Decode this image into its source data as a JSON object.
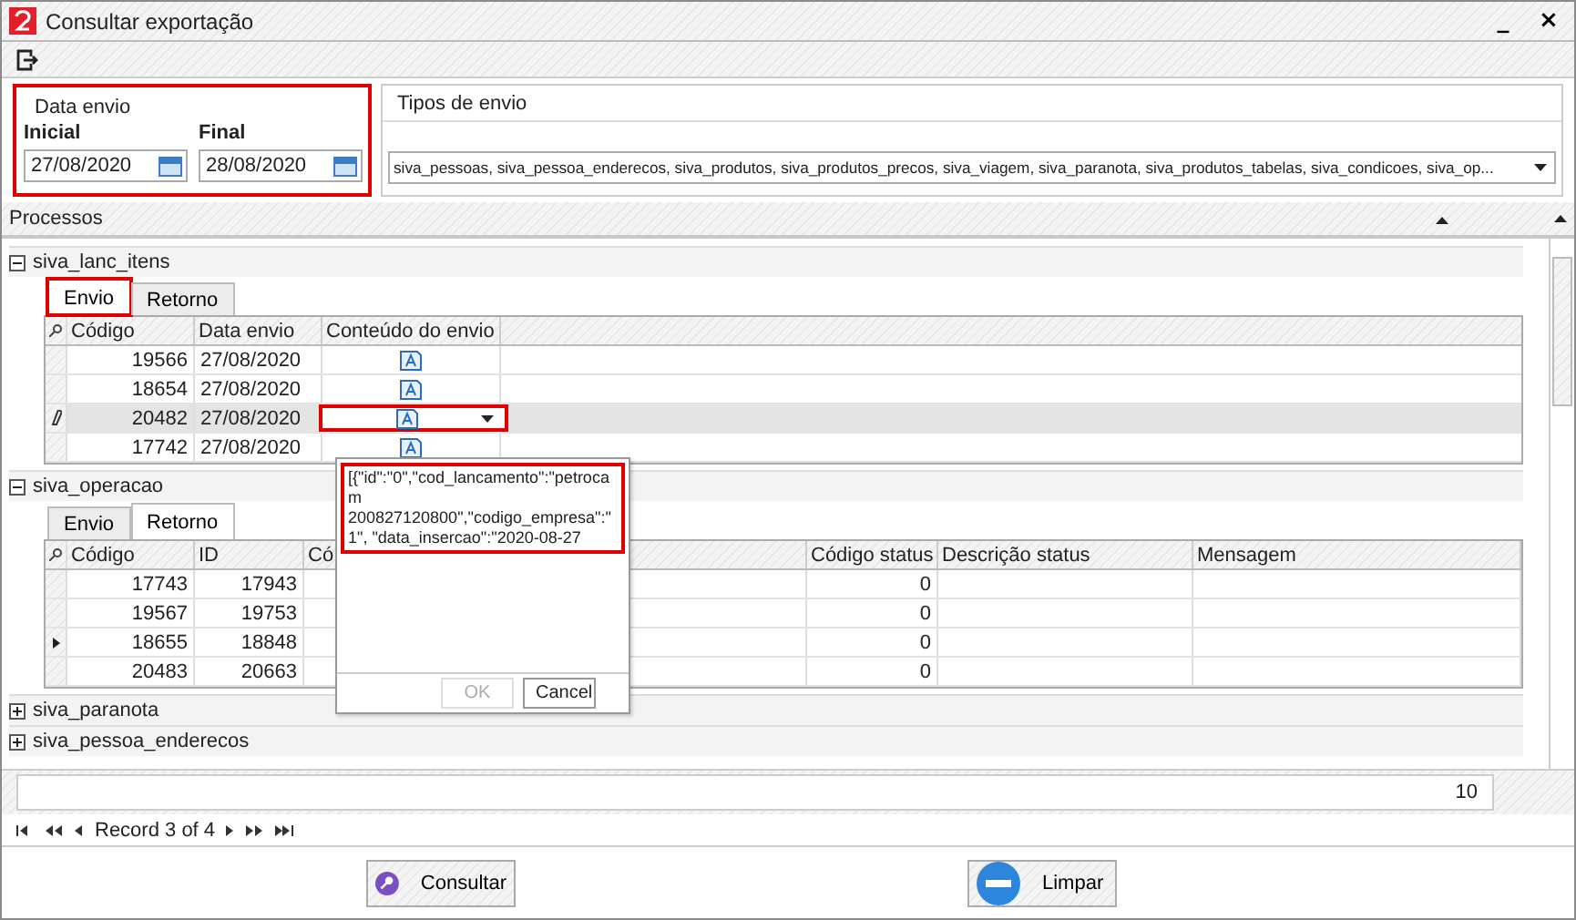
{
  "window": {
    "title": "Consultar exportação",
    "controls": [
      "_",
      "×"
    ]
  },
  "date_filter": {
    "title": "Data envio",
    "highlighted": true,
    "fields": [
      {
        "label": "Inicial",
        "value": "27/08/2020"
      },
      {
        "label": "Final",
        "value": "28/08/2020"
      }
    ]
  },
  "send_types": {
    "title": "Tipos de envio",
    "value": "siva_pessoas, siva_pessoa_enderecos, siva_produtos, siva_produtos_precos, siva_viagem, siva_paranota, siva_produtos_tabelas, siva_condicoes, siva_op..."
  },
  "processes": {
    "title": "Processos",
    "groups": [
      {
        "name": "siva_lanc_itens",
        "expanded": true,
        "tabs": [
          {
            "label": "Envio",
            "selected": true,
            "highlighted": true
          },
          {
            "label": "Retorno",
            "selected": false,
            "highlighted": false
          }
        ],
        "grid": {
          "editing": true,
          "editor_highlighted": true,
          "columns": [
            {
              "label": "Código",
              "kind": "number"
            },
            {
              "label": "Data envio",
              "kind": "text"
            },
            {
              "label": "Conteúdo do envio",
              "kind": "content"
            }
          ],
          "rows": [
            {
              "selected": false,
              "cells": [
                "19566",
                "27/08/2020",
                null
              ]
            },
            {
              "selected": false,
              "cells": [
                "18654",
                "27/08/2020",
                null
              ]
            },
            {
              "selected": true,
              "cells": [
                "20482",
                "27/08/2020",
                null
              ]
            },
            {
              "selected": false,
              "cells": [
                "17742",
                "27/08/2020",
                null
              ]
            }
          ]
        }
      },
      {
        "name": "siva_operacao",
        "expanded": true,
        "tabs": [
          {
            "label": "Envio",
            "selected": false,
            "highlighted": false
          },
          {
            "label": "Retorno",
            "selected": true,
            "highlighted": false
          }
        ],
        "grid": {
          "editing": false,
          "columns": [
            {
              "label": "Código",
              "kind": "number"
            },
            {
              "label": "ID",
              "kind": "number"
            },
            {
              "label": "Có",
              "kind": "text"
            },
            {
              "label": "Código status",
              "kind": "number"
            },
            {
              "label": "Descrição status",
              "kind": "text"
            },
            {
              "label": "Mensagem",
              "kind": "text"
            }
          ],
          "rows": [
            {
              "selected": false,
              "cells": [
                "17743",
                "17943",
                null,
                "0",
                null,
                null
              ]
            },
            {
              "selected": false,
              "cells": [
                "19567",
                "19753",
                null,
                "0",
                null,
                null
              ]
            },
            {
              "selected": true,
              "cells": [
                "18655",
                "18848",
                null,
                "0",
                null,
                null
              ]
            },
            {
              "selected": false,
              "cells": [
                "20483",
                "20663",
                null,
                "0",
                null,
                null
              ]
            }
          ]
        }
      },
      {
        "name": "siva_paranota",
        "expanded": false
      },
      {
        "name": "siva_pessoa_enderecos",
        "expanded": false
      }
    ]
  },
  "popup": {
    "text": "[{\"id\":\"0\",\"cod_lancamento\":\"petrocam 200827120800\",\"codigo_empresa\":\"1\", \"data_insercao\":\"2020-08-27",
    "highlighted": true,
    "buttons": [
      {
        "label": "OK",
        "disabled": true
      },
      {
        "label": "Cancel",
        "disabled": false
      }
    ]
  },
  "footer": {
    "total": "10"
  },
  "navigator": {
    "record": "Record 3 of 4"
  },
  "buttons": [
    {
      "label": "Consultar",
      "kind": "search"
    },
    {
      "label": "Limpar",
      "kind": "clear"
    }
  ]
}
